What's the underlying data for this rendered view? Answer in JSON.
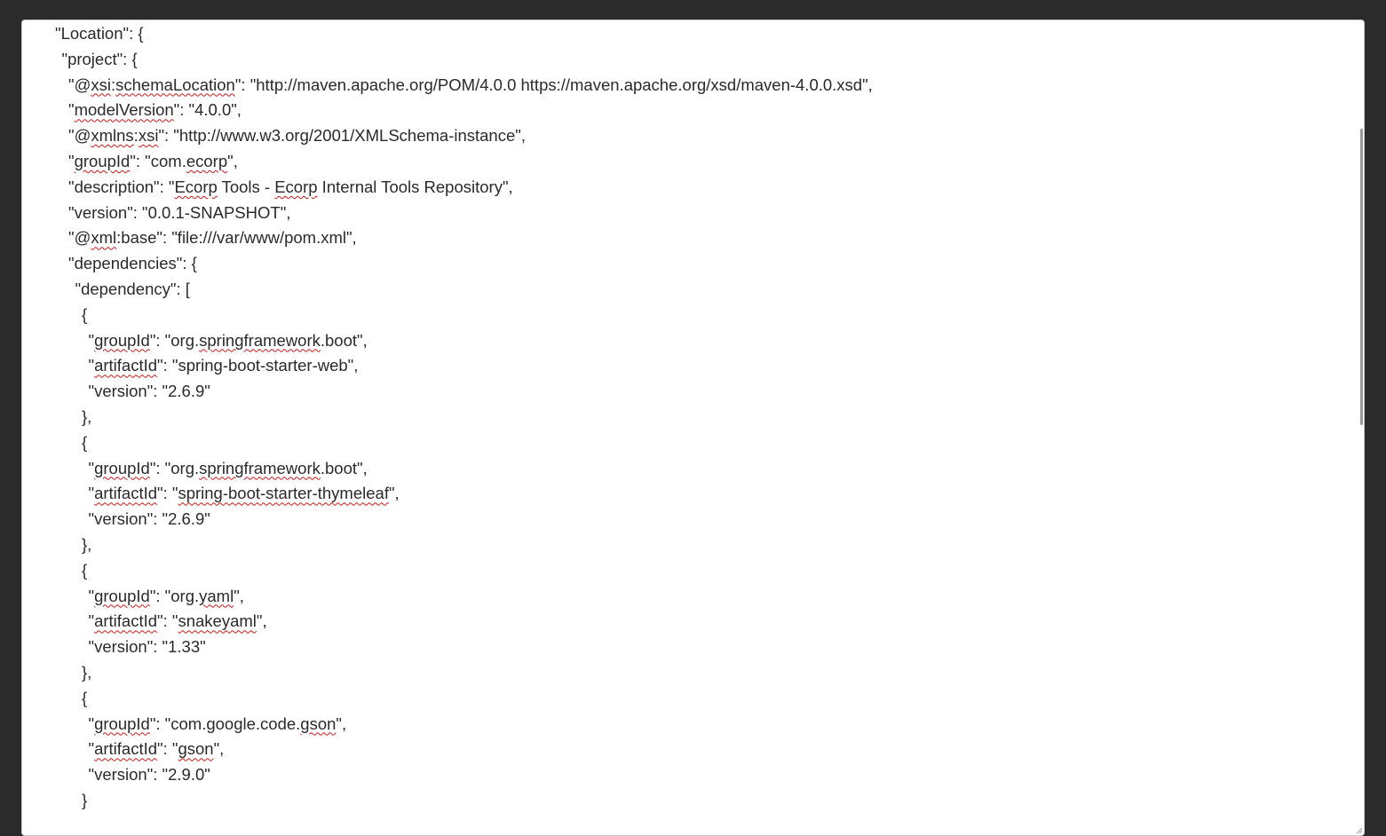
{
  "editor": {
    "lines": [
      {
        "indent": 0,
        "segments": [
          {
            "t": "\"Location\": {",
            "s": false
          }
        ]
      },
      {
        "indent": 1,
        "segments": [
          {
            "t": "\"project\": {",
            "s": false
          }
        ]
      },
      {
        "indent": 2,
        "segments": [
          {
            "t": "\"@",
            "s": false
          },
          {
            "t": "xsi",
            "s": true
          },
          {
            "t": ":",
            "s": false
          },
          {
            "t": "schemaLocation",
            "s": true
          },
          {
            "t": "\": \"http://maven.apache.org/POM/4.0.0 https://maven.apache.org/xsd/maven-4.0.0.xsd\",",
            "s": false
          }
        ]
      },
      {
        "indent": 2,
        "segments": [
          {
            "t": "\"",
            "s": false
          },
          {
            "t": "modelVersion",
            "s": true
          },
          {
            "t": "\": \"4.0.0\",",
            "s": false
          }
        ]
      },
      {
        "indent": 2,
        "segments": [
          {
            "t": "\"@",
            "s": false
          },
          {
            "t": "xmlns",
            "s": true
          },
          {
            "t": ":",
            "s": false
          },
          {
            "t": "xsi",
            "s": true
          },
          {
            "t": "\": \"http://www.w3.org/2001/XMLSchema-instance\",",
            "s": false
          }
        ]
      },
      {
        "indent": 2,
        "segments": [
          {
            "t": "\"",
            "s": false
          },
          {
            "t": "groupId",
            "s": true
          },
          {
            "t": "\": \"com.",
            "s": false
          },
          {
            "t": "ecorp",
            "s": true
          },
          {
            "t": "\",",
            "s": false
          }
        ]
      },
      {
        "indent": 2,
        "segments": [
          {
            "t": "\"description\": \"",
            "s": false
          },
          {
            "t": "Ecorp",
            "s": true
          },
          {
            "t": " Tools - ",
            "s": false
          },
          {
            "t": "Ecorp",
            "s": true
          },
          {
            "t": " Internal Tools Repository\",",
            "s": false
          }
        ]
      },
      {
        "indent": 2,
        "segments": [
          {
            "t": "\"version\": \"0.0.1-SNAPSHOT\",",
            "s": false
          }
        ]
      },
      {
        "indent": 2,
        "segments": [
          {
            "t": "\"@",
            "s": false
          },
          {
            "t": "xml",
            "s": true
          },
          {
            "t": ":base\": \"file:///var/www/pom.xml\",",
            "s": false
          }
        ]
      },
      {
        "indent": 2,
        "segments": [
          {
            "t": "\"dependencies\": {",
            "s": false
          }
        ]
      },
      {
        "indent": 3,
        "segments": [
          {
            "t": "\"dependency\": [",
            "s": false
          }
        ]
      },
      {
        "indent": 4,
        "segments": [
          {
            "t": "{",
            "s": false
          }
        ]
      },
      {
        "indent": 5,
        "segments": [
          {
            "t": "\"",
            "s": false
          },
          {
            "t": "groupId",
            "s": true
          },
          {
            "t": "\": \"org.",
            "s": false
          },
          {
            "t": "springframework",
            "s": true
          },
          {
            "t": ".boot\",",
            "s": false
          }
        ]
      },
      {
        "indent": 5,
        "segments": [
          {
            "t": "\"",
            "s": false
          },
          {
            "t": "artifactId",
            "s": true
          },
          {
            "t": "\": \"spring-boot-starter-web\",",
            "s": false
          }
        ]
      },
      {
        "indent": 5,
        "segments": [
          {
            "t": "\"version\": \"2.6.9\"",
            "s": false
          }
        ]
      },
      {
        "indent": 4,
        "segments": [
          {
            "t": "},",
            "s": false
          }
        ]
      },
      {
        "indent": 4,
        "segments": [
          {
            "t": "{",
            "s": false
          }
        ]
      },
      {
        "indent": 5,
        "segments": [
          {
            "t": "\"",
            "s": false
          },
          {
            "t": "groupId",
            "s": true
          },
          {
            "t": "\": \"org.",
            "s": false
          },
          {
            "t": "springframework",
            "s": true
          },
          {
            "t": ".boot\",",
            "s": false
          }
        ]
      },
      {
        "indent": 5,
        "segments": [
          {
            "t": "\"",
            "s": false
          },
          {
            "t": "artifactId",
            "s": true
          },
          {
            "t": "\": \"",
            "s": false
          },
          {
            "t": "spring-boot-starter-thymeleaf",
            "s": true
          },
          {
            "t": "\",",
            "s": false
          }
        ]
      },
      {
        "indent": 5,
        "segments": [
          {
            "t": "\"version\": \"2.6.9\"",
            "s": false
          }
        ]
      },
      {
        "indent": 4,
        "segments": [
          {
            "t": "},",
            "s": false
          }
        ]
      },
      {
        "indent": 4,
        "segments": [
          {
            "t": "{",
            "s": false
          }
        ]
      },
      {
        "indent": 5,
        "segments": [
          {
            "t": "\"",
            "s": false
          },
          {
            "t": "groupId",
            "s": true
          },
          {
            "t": "\": \"org.",
            "s": false
          },
          {
            "t": "yaml",
            "s": true
          },
          {
            "t": "\",",
            "s": false
          }
        ]
      },
      {
        "indent": 5,
        "segments": [
          {
            "t": "\"",
            "s": false
          },
          {
            "t": "artifactId",
            "s": true
          },
          {
            "t": "\": \"",
            "s": false
          },
          {
            "t": "snakeyaml",
            "s": true
          },
          {
            "t": "\",",
            "s": false
          }
        ]
      },
      {
        "indent": 5,
        "segments": [
          {
            "t": "\"version\": \"1.33\"",
            "s": false
          }
        ]
      },
      {
        "indent": 4,
        "segments": [
          {
            "t": "},",
            "s": false
          }
        ]
      },
      {
        "indent": 4,
        "segments": [
          {
            "t": "{",
            "s": false
          }
        ]
      },
      {
        "indent": 5,
        "segments": [
          {
            "t": "\"",
            "s": false
          },
          {
            "t": "groupId",
            "s": true
          },
          {
            "t": "\": \"com.google.code.",
            "s": false
          },
          {
            "t": "gson",
            "s": true
          },
          {
            "t": "\",",
            "s": false
          }
        ]
      },
      {
        "indent": 5,
        "segments": [
          {
            "t": "\"",
            "s": false
          },
          {
            "t": "artifactId",
            "s": true
          },
          {
            "t": "\": \"",
            "s": false
          },
          {
            "t": "gson",
            "s": true
          },
          {
            "t": "\",",
            "s": false
          }
        ]
      },
      {
        "indent": 5,
        "segments": [
          {
            "t": "\"version\": \"2.9.0\"",
            "s": false
          }
        ]
      },
      {
        "indent": 4,
        "segments": [
          {
            "t": "}",
            "s": false
          }
        ]
      }
    ]
  },
  "colors": {
    "background": "#2b2b2b",
    "editor_bg": "#ffffff",
    "text": "#2a2a2a",
    "spellcheck_underline": "#d01818",
    "scrollbar_thumb": "#9a9a9a"
  },
  "icons": {
    "resize_grip": "resize-grip-icon"
  }
}
